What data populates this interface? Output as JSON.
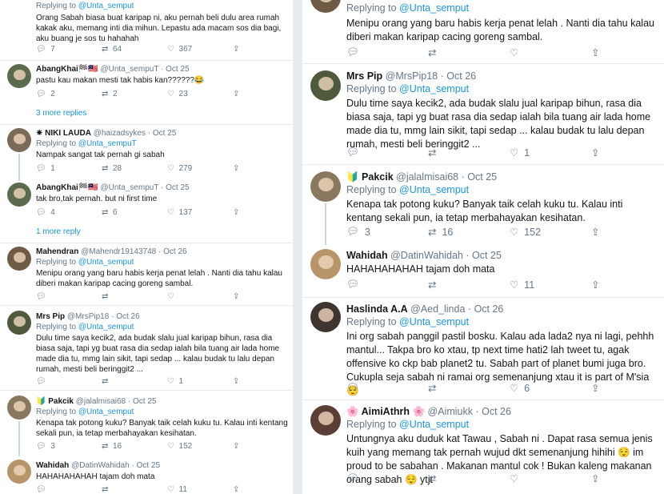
{
  "left": {
    "tweets": [
      {
        "id": "l0",
        "replying_prefix": "Replying to",
        "replying_to": "@Unta_semput",
        "body": "Orang Sabah biasa buat karipap ni, aku pernah beli dulu area rumah kakak aku, memang inti dia mihun. Lepastu ada macam sos dia bagi, aku buang je sos tu hahahah",
        "replies": "7",
        "retweets": "64",
        "likes": "367"
      },
      {
        "id": "l1",
        "name": "AbangKhai🏁🇲🇾",
        "handle": "@Unta_sempuT",
        "date": "Oct 25",
        "body": "pastu kau makan mesti tak habis kan??????😂",
        "replies": "2",
        "retweets": "2",
        "likes": "23"
      },
      {
        "id": "l2",
        "name": "✷ NIKI LAUDA",
        "handle": "@haizadsykes",
        "date": "Oct 25",
        "replying_prefix": "Replying to",
        "replying_to": "@Unta_sempuT",
        "body": "Nampak sangat tak pernah gi sabah",
        "replies": "1",
        "retweets": "28",
        "likes": "279"
      },
      {
        "id": "l3",
        "name": "AbangKhai🏁🇲🇾",
        "handle": "@Unta_sempuT",
        "date": "Oct 25",
        "body": "tak bro,tak pernah. but ni first time",
        "replies": "4",
        "retweets": "6",
        "likes": "137"
      },
      {
        "id": "l4",
        "name": "Mahendran",
        "handle": "@Mahendr19143748",
        "date": "Oct 26",
        "replying_prefix": "Replying to",
        "replying_to": "@Unta_semput",
        "body": "Menipu orang yang baru habis kerja penat lelah . Nanti dia tahu kalau diberi makan karipap cacing goreng sambal.",
        "replies": "",
        "retweets": "",
        "likes": ""
      },
      {
        "id": "l5",
        "name": "Mrs Pip",
        "handle": "@MrsPip18",
        "date": "Oct 26",
        "replying_prefix": "Replying to",
        "replying_to": "@Unta_semput",
        "body": "Dulu time saya kecik2, ada budak slalu jual karipap bihun, rasa dia biasa saja, tapi yg buat rasa dia sedap ialah bila tuang air lada home made dia tu, mmg lain sikit, tapi sedap ... kalau budak tu lalu depan rumah, mesti beli beringgit2 ...",
        "replies": "",
        "retweets": "",
        "likes": "1"
      },
      {
        "id": "l6",
        "name": "🔰 Pakcik",
        "handle": "@jalalmisai68",
        "date": "Oct 25",
        "replying_prefix": "Replying to",
        "replying_to": "@Unta_semput",
        "body": "Kenapa tak potong kuku? Banyak taik celah kuku tu. Kalau inti kentang sekali pun, ia tetap merbahayakan kesihatan.",
        "replies": "3",
        "retweets": "16",
        "likes": "152"
      },
      {
        "id": "l7",
        "name": "Wahidah",
        "handle": "@DatinWahidah",
        "date": "Oct 25",
        "body": "HAHAHAHAHAH tajam doh mata",
        "replies": "",
        "retweets": "",
        "likes": "11"
      }
    ],
    "more_1": "3 more replies",
    "more_2": "1 more reply"
  },
  "right": {
    "tweets": [
      {
        "id": "r0",
        "replying_prefix": "Replying to",
        "replying_to": "@Unta_semput",
        "body": "Menipu orang yang baru habis kerja penat lelah . Nanti dia tahu kalau diberi makan karipap cacing goreng sambal.",
        "replies": "",
        "retweets": "",
        "likes": ""
      },
      {
        "id": "r1",
        "name": "Mrs Pip",
        "handle": "@MrsPip18",
        "date": "Oct 26",
        "replying_prefix": "Replying to",
        "replying_to": "@Unta_semput",
        "body": "Dulu time saya kecik2, ada budak slalu jual karipap bihun, rasa dia biasa saja, tapi yg buat rasa dia sedap ialah bila tuang air lada home made dia tu, mmg lain sikit, tapi sedap ... kalau budak tu lalu depan rumah, mesti beli beringgit2 ...",
        "replies": "",
        "retweets": "",
        "likes": "1"
      },
      {
        "id": "r2",
        "name": "🔰 Pakcik",
        "handle": "@jalalmisai68",
        "date": "Oct 25",
        "replying_prefix": "Replying to",
        "replying_to": "@Unta_semput",
        "body": "Kenapa tak potong kuku? Banyak taik celah kuku tu. Kalau inti kentang sekali pun, ia tetap merbahayakan kesihatan.",
        "replies": "3",
        "retweets": "16",
        "likes": "152"
      },
      {
        "id": "r3",
        "name": "Wahidah",
        "handle": "@DatinWahidah",
        "date": "Oct 25",
        "body": "HAHAHAHAHAH tajam doh mata",
        "replies": "",
        "retweets": "",
        "likes": "11"
      },
      {
        "id": "r4",
        "name": "Haslinda A.A",
        "handle": "@Aed_linda",
        "date": "Oct 26",
        "replying_prefix": "Replying to",
        "replying_to": "@Unta_semput",
        "body": "Ini org sabah panggil pastil bosku. Kalau ada lada2 nya ni lagi, pehhh mantul... Takpa bro ko xtau, tp next time hati2 lah tweet tu, agak offensive ko ckp bab planet2 tu. Sabah part of planet bumi juga bro. Cukupla seja sabah ni ramai org semenanjung xtau it is part of M'sia",
        "emoji_after": "😌",
        "replies": "",
        "retweets": "",
        "likes": "6"
      },
      {
        "id": "r5",
        "name": "🌸 AimiAthrh 🌸",
        "handle": "@Aimiukk",
        "date": "Oct 26",
        "replying_prefix": "Replying to",
        "replying_to": "@Unta_semput",
        "body": "Untungnya aku duduk kat Tawau , Sabah ni . Dapat rasa semua jenis kuih yang memang tak pernah wujud dkt semenanjung hihihi 😌 im proud to be sabahan . Makanan mantul cok ! Bukan kaleng makanan orang sabah 😌 ytjt",
        "replies": "",
        "retweets": "",
        "likes": ""
      }
    ]
  },
  "icons": {
    "reply": "reply-icon",
    "retweet": "retweet-icon",
    "like": "heart-icon",
    "share": "share-icon"
  },
  "colors": {
    "link": "#1b95e0",
    "muted": "#657786",
    "divider": "#e6ecf0",
    "text": "#14171a"
  }
}
